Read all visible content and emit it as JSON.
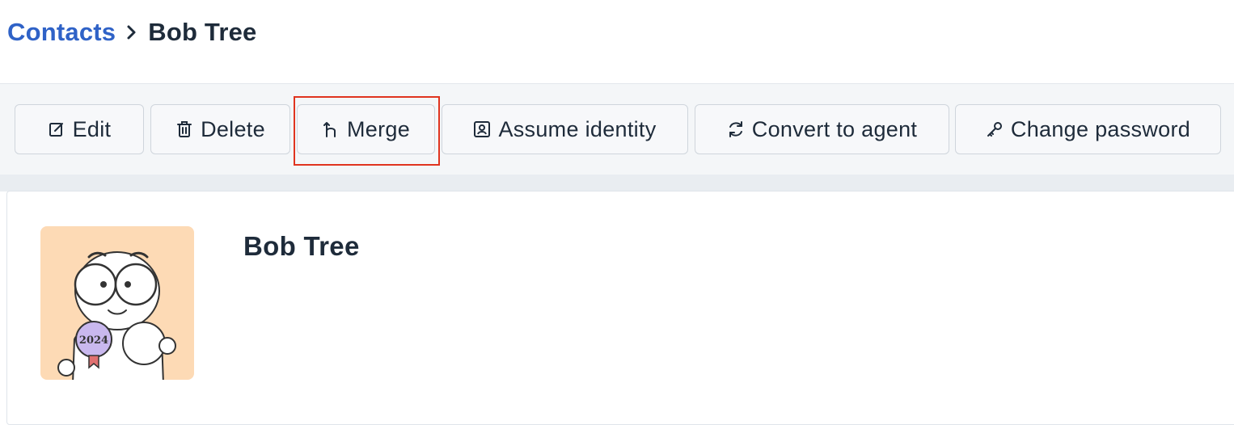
{
  "breadcrumb": {
    "parent": "Contacts",
    "current": "Bob Tree"
  },
  "toolbar": {
    "buttons": [
      {
        "label": "Edit",
        "icon": "edit-icon"
      },
      {
        "label": "Delete",
        "icon": "trash-icon"
      },
      {
        "label": "Merge",
        "icon": "merge-icon",
        "highlighted": true
      },
      {
        "label": "Assume identity",
        "icon": "identity-icon"
      },
      {
        "label": "Convert to agent",
        "icon": "convert-icon"
      },
      {
        "label": "Change password",
        "icon": "key-icon"
      }
    ]
  },
  "contact": {
    "name": "Bob Tree",
    "avatar_badge": "2024"
  },
  "colors": {
    "link": "#2f62c7",
    "text": "#1e2b3a",
    "highlight": "#e0341f",
    "avatar_bg": "#fddab5"
  }
}
